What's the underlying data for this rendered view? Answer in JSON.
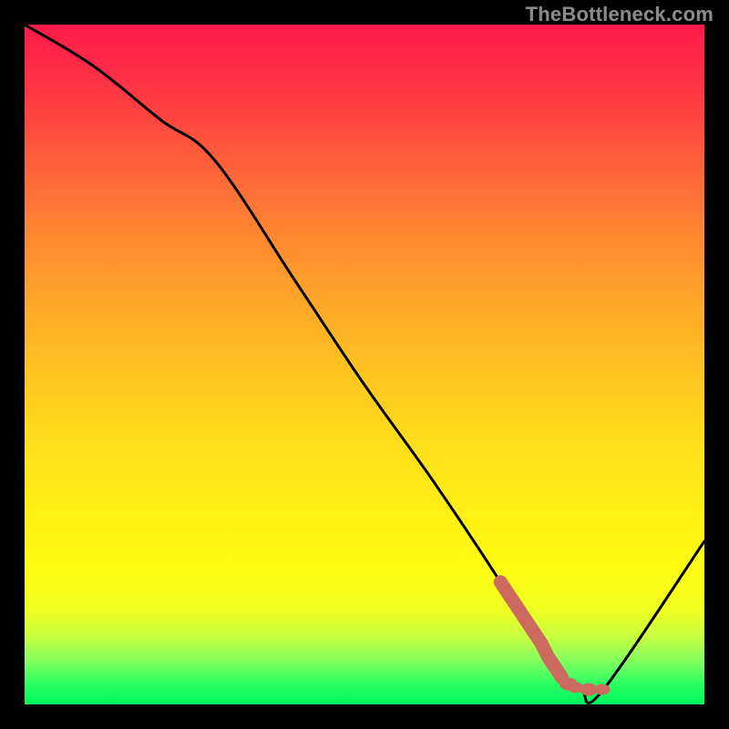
{
  "attribution": "TheBottleneck.com",
  "colors": {
    "background": "#000000",
    "curve": "#000000",
    "highlight": "#cc6a60"
  },
  "chart_data": {
    "type": "line",
    "title": "",
    "xlabel": "",
    "ylabel": "",
    "xlim": [
      0,
      100
    ],
    "ylim": [
      0,
      100
    ],
    "grid": false,
    "legend": false,
    "series": [
      {
        "name": "bottleneck-curve",
        "x": [
          0,
          10,
          20,
          28,
          40,
          50,
          60,
          70,
          78,
          80,
          82,
          85,
          100
        ],
        "y": [
          100,
          94,
          86,
          80,
          62,
          47,
          33,
          18,
          5,
          3,
          2,
          2,
          24
        ]
      }
    ],
    "annotations": [
      {
        "name": "highlight-segment",
        "type": "scatter",
        "x": [
          70,
          71,
          72,
          73,
          74,
          75,
          76,
          77,
          78,
          79,
          80,
          81,
          82,
          83,
          84,
          85
        ],
        "y": [
          18,
          16.5,
          15,
          13.5,
          12,
          10.5,
          9,
          7,
          5.5,
          4,
          3,
          2.5,
          2.2,
          2.2,
          2.2,
          2.2
        ]
      }
    ]
  }
}
